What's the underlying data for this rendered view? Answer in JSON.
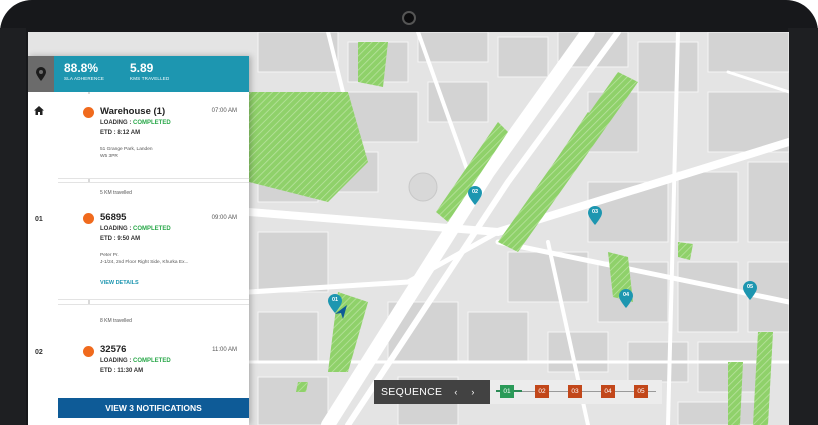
{
  "sidebar": {
    "stats": [
      {
        "value": "88.8%",
        "label": "SLA ADHERENCE"
      },
      {
        "value": "5.89",
        "label": "KMS TRAVELLED"
      }
    ],
    "stops": [
      {
        "index": "",
        "title": "Warehouse (1)",
        "time": "07:00 AM",
        "loading_label": "LOADING :",
        "status": "COMPLETED",
        "etd_label": "ETD :",
        "etd": "8:12 AM",
        "address_lines": [
          "51 Grange Park, Landen",
          "W5 3PR"
        ],
        "travelled": "",
        "link": ""
      },
      {
        "index": "01",
        "title": "56895",
        "time": "09:00 AM",
        "loading_label": "LOADING :",
        "status": "COMPLETED",
        "etd_label": "ETD :",
        "etd": "9:50 AM",
        "address_lines": [
          "Peter Pr.",
          "J-1/24, 2nd Floor Right Side, Khurka Ex..."
        ],
        "travelled": "5 KM travelled",
        "link": "VIEW DETAILS"
      },
      {
        "index": "02",
        "title": "32576",
        "time": "11:00 AM",
        "loading_label": "LOADING :",
        "status": "COMPLETED",
        "etd_label": "ETD :",
        "etd": "11:30 AM",
        "address_lines": [],
        "travelled": "8 KM travelled",
        "link": ""
      }
    ],
    "notifications_button": "VIEW 3 NOTIFICATIONS",
    "location_icon": "map-marker-icon",
    "home_icon": "home-icon"
  },
  "map": {
    "pins": [
      "01",
      "02",
      "03",
      "04",
      "05"
    ],
    "current_location_icon": "navigation-arrow-icon"
  },
  "sequence": {
    "label": "SEQUENCE",
    "prev": "‹",
    "next": "›",
    "stops": [
      {
        "label": "01",
        "state": "done"
      },
      {
        "label": "02",
        "state": "pending"
      },
      {
        "label": "03",
        "state": "pending"
      },
      {
        "label": "04",
        "state": "pending"
      },
      {
        "label": "05",
        "state": "pending"
      }
    ]
  },
  "colors": {
    "accent": "#1d96b0",
    "notification": "#0e5b97",
    "stop_dot": "#f06a1d",
    "completed": "#2aa84a",
    "park": "#8fd16a"
  }
}
